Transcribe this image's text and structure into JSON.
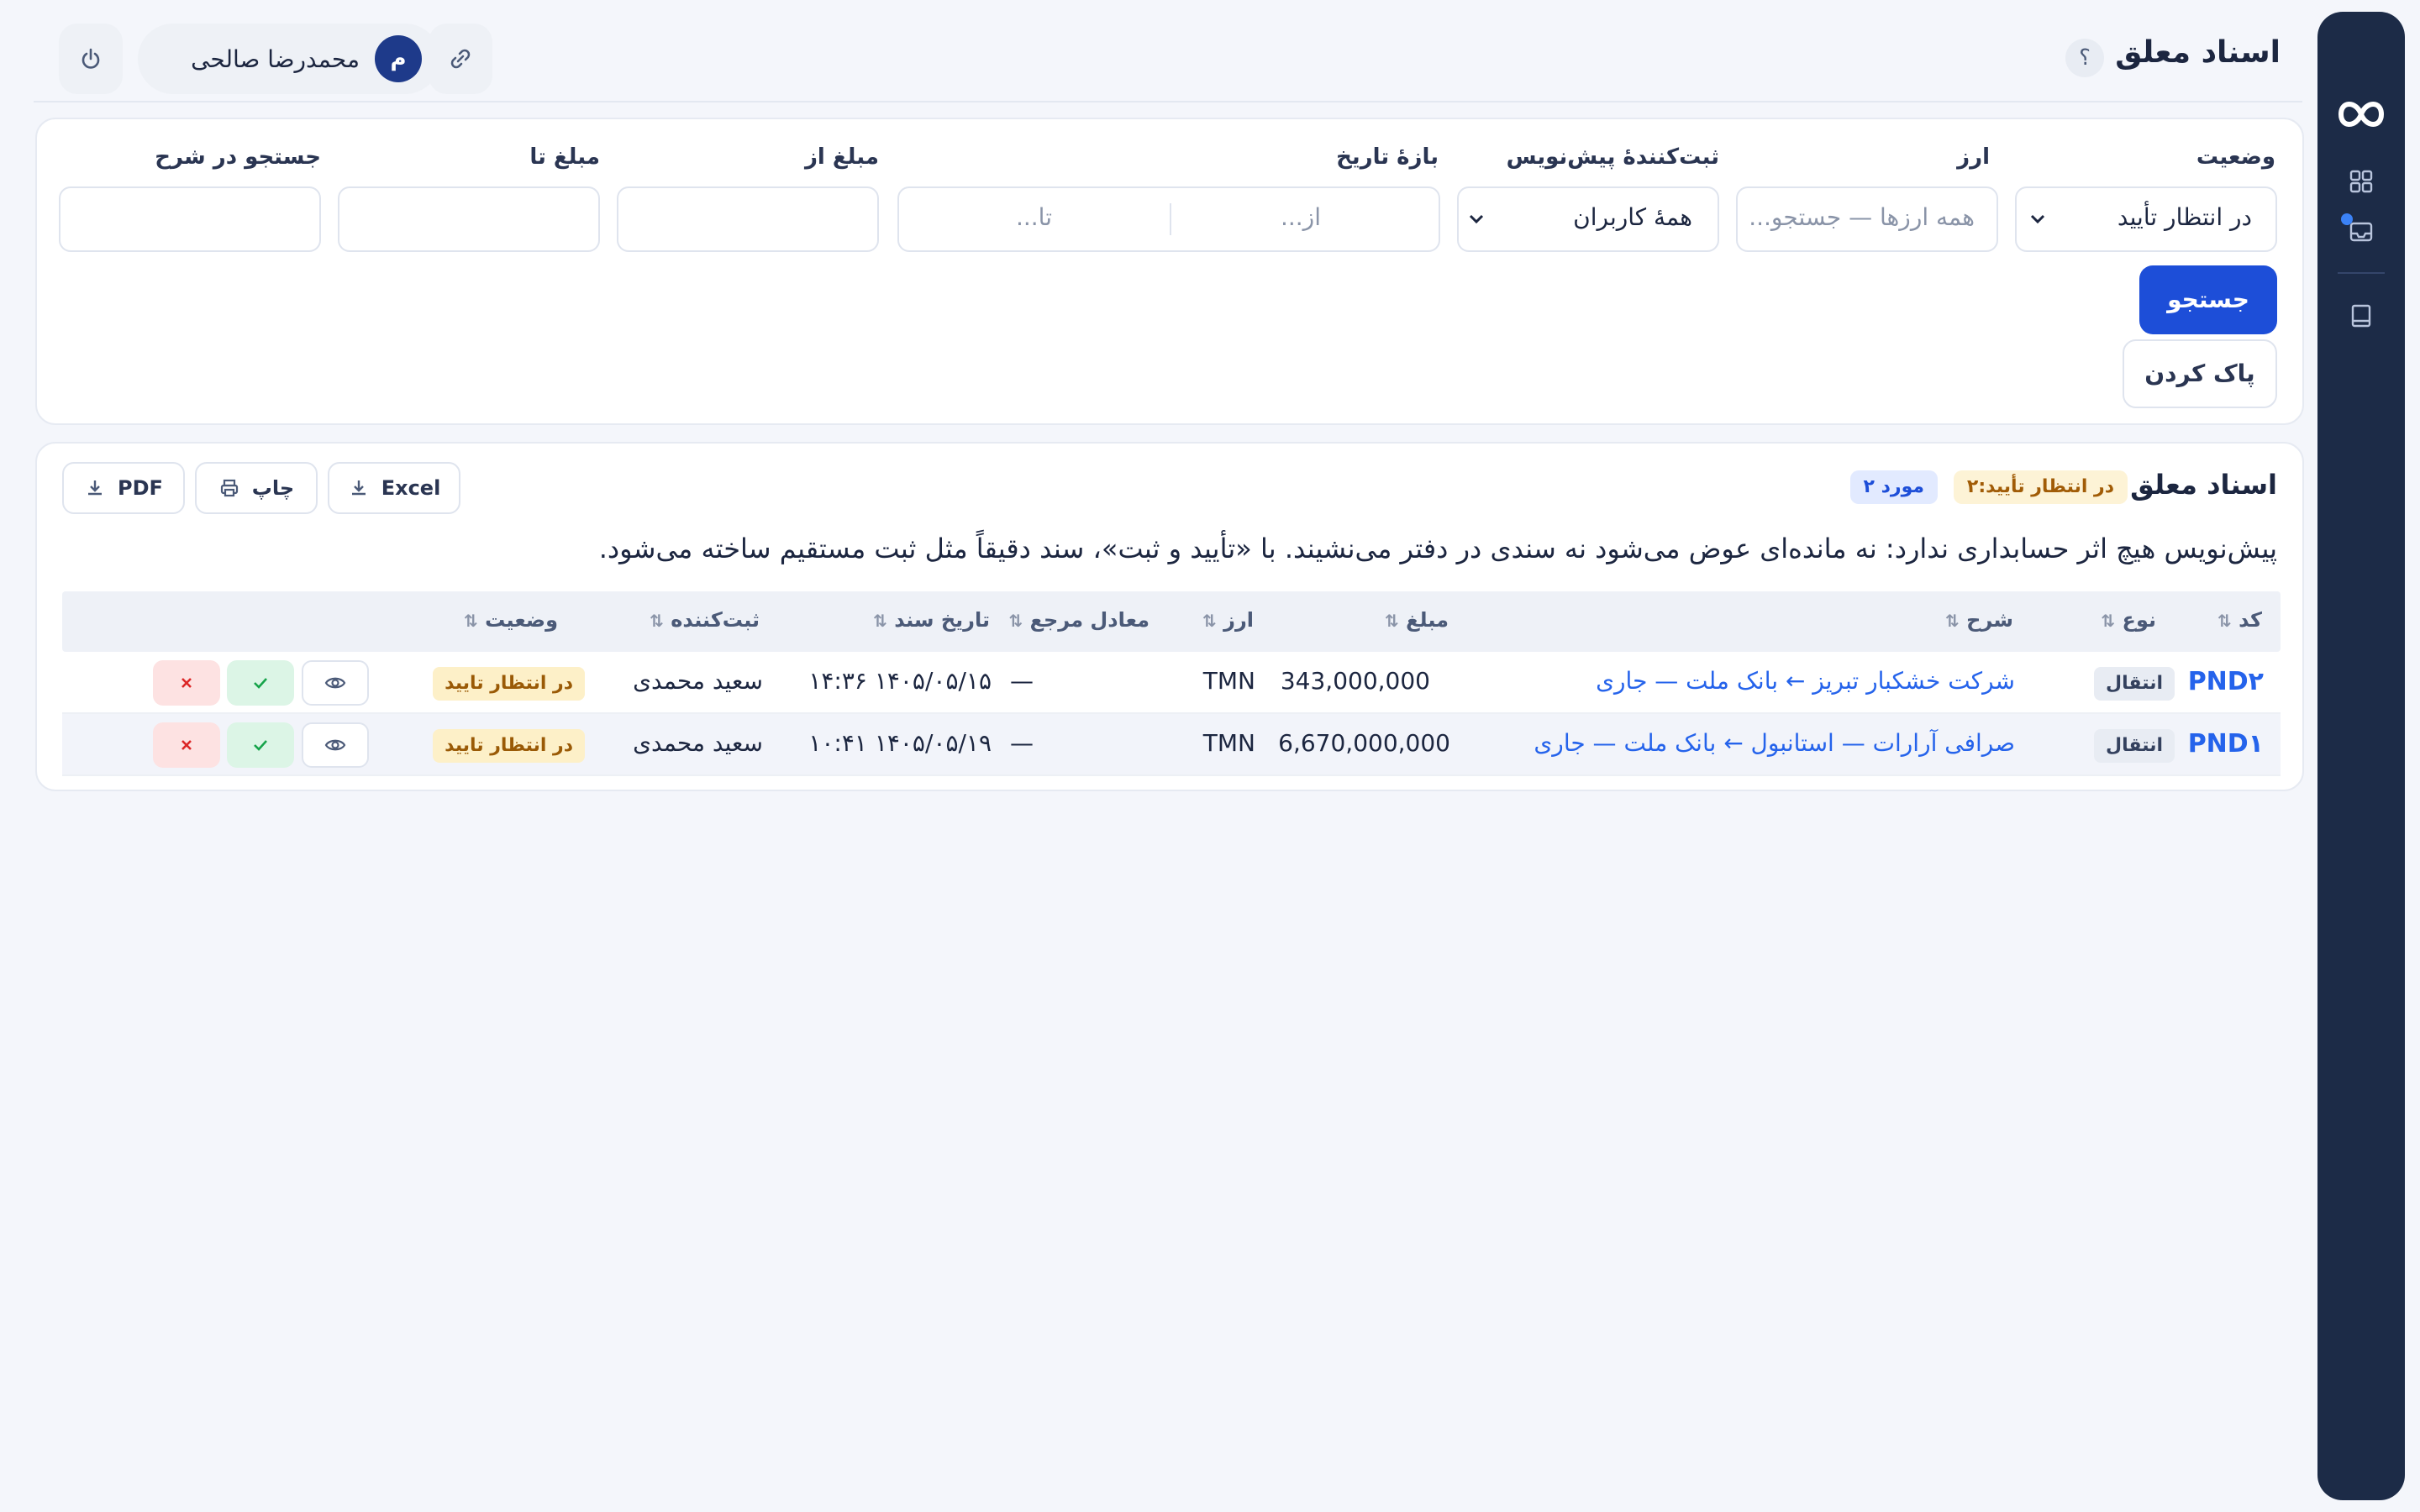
{
  "header": {
    "title": "اسناد معلق",
    "help": "؟",
    "user": {
      "initial": "م",
      "name": "محمدرضا صالحی"
    }
  },
  "filters": {
    "status": {
      "label": "وضعیت",
      "value": "در انتظار تأیید"
    },
    "currency": {
      "label": "ارز",
      "placeholder": "همه ارزها — جستجو..."
    },
    "drafter": {
      "label": "ثبت‌کنندهٔ پیش‌نویس",
      "value": "همهٔ کاربران"
    },
    "date_range": {
      "label": "بازهٔ تاریخ",
      "from_placeholder": "از...",
      "to_placeholder": "تا..."
    },
    "amount_from": {
      "label": "مبلغ از",
      "value": ""
    },
    "amount_to": {
      "label": "مبلغ تا",
      "value": ""
    },
    "description": {
      "label": "جستجو در شرح",
      "value": ""
    },
    "search_label": "جستجو",
    "clear_label": "پاک کردن"
  },
  "list": {
    "title": "اسناد معلق",
    "pending_badge": "در انتظار تأیید:۲",
    "count_badge": "۲ مورد",
    "export": {
      "excel": "Excel",
      "print": "چاپ",
      "pdf": "PDF"
    },
    "description": "پیش‌نویس هیچ اثر حسابداری ندارد: نه مانده‌ای عوض می‌شود نه سندی در دفتر می‌نشیند. با «تأیید و ثبت»، سند دقیقاً مثل ثبت مستقیم ساخته می‌شود.",
    "columns": {
      "code": "کد",
      "type": "نوع",
      "desc": "شرح",
      "amount": "مبلغ",
      "currency": "ارز",
      "ref": "معادل مرجع",
      "date": "تاریخ سند",
      "creator": "ثبت‌کننده",
      "status": "وضعیت",
      "sort_icon": "⇅"
    },
    "rows": [
      {
        "code": "PND۲",
        "type": "انتقال",
        "desc": "شرکت خشکبار تبریز ← بانک ملت — جاری",
        "amount": "343,000,000",
        "currency": "TMN",
        "ref": "—",
        "date": "۱۴۰۵/۰۵/۱۵ ۱۴:۳۶",
        "creator": "سعید محمدی",
        "status": "در انتظار تایید"
      },
      {
        "code": "PND۱",
        "type": "انتقال",
        "desc": "صرافی آرارات — استانبول ← بانک ملت — جاری",
        "amount": "6,670,000,000",
        "currency": "TMN",
        "ref": "—",
        "date": "۱۴۰۵/۰۵/۱۹ ۱۰:۴۱",
        "creator": "سعید محمدی",
        "status": "در انتظار تایید"
      }
    ]
  },
  "icons": {
    "logo": "infinity-logo",
    "rail": [
      "dashboard-icon",
      "inbox-icon",
      "book-icon"
    ],
    "topbar": [
      "link-icon",
      "moon-icon",
      "power-icon"
    ]
  },
  "colors": {
    "accent": "#1d4ed8",
    "rail": "#1c2b47",
    "pending": "#fdf0c8",
    "link": "#2563eb"
  }
}
